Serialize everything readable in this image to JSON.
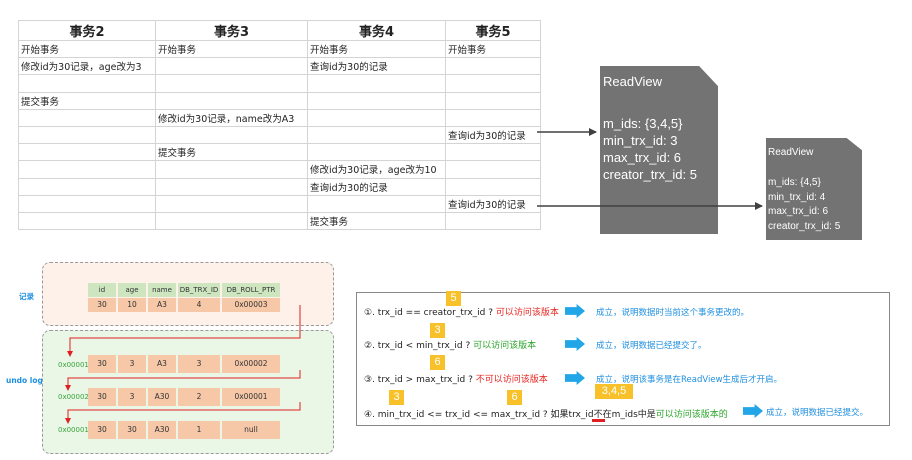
{
  "table": {
    "headers": [
      "事务2",
      "事务3",
      "事务4",
      "事务5"
    ],
    "rows": [
      [
        "开始事务",
        "开始事务",
        "开始事务",
        "开始事务"
      ],
      [
        "修改id为30记录，age改为3",
        "",
        "查询id为30的记录",
        ""
      ],
      [
        "",
        "",
        "",
        ""
      ],
      [
        "提交事务",
        "",
        "",
        ""
      ],
      [
        "",
        "修改id为30记录，name改为A3",
        "",
        ""
      ],
      [
        "",
        "",
        "",
        "查询id为30的记录"
      ],
      [
        "",
        "提交事务",
        "",
        ""
      ],
      [
        "",
        "",
        "修改id为30记录，age改为10",
        ""
      ],
      [
        "",
        "",
        "查询id为30的记录",
        ""
      ],
      [
        "",
        "",
        "",
        "查询id为30的记录"
      ],
      [
        "",
        "",
        "提交事务",
        ""
      ]
    ]
  },
  "readviews": [
    {
      "title": "ReadView",
      "m_ids": "m_ids: {3,4,5}",
      "min_trx_id": "min_trx_id: 3",
      "max_trx_id": "max_trx_id: 6",
      "creator_trx_id": "creator_trx_id: 5"
    },
    {
      "title": "ReadView",
      "m_ids": "m_ids: {4,5}",
      "min_trx_id": "min_trx_id: 4",
      "max_trx_id": "max_trx_id: 6",
      "creator_trx_id": "creator_trx_id: 5"
    }
  ],
  "labels": {
    "record": "记录",
    "undo_log": "undo log"
  },
  "record": {
    "headers": [
      "id",
      "age",
      "name",
      "DB_TRX_ID",
      "DB_ROLL_PTR"
    ],
    "values": [
      "30",
      "10",
      "A3",
      "4",
      "0x00003"
    ]
  },
  "undo_log": [
    {
      "addr": "0x00001",
      "values": [
        "30",
        "3",
        "A3",
        "3",
        "0x00002"
      ]
    },
    {
      "addr": "0x00002",
      "values": [
        "30",
        "3",
        "A30",
        "2",
        "0x00001"
      ]
    },
    {
      "addr": "0x00001",
      "values": [
        "30",
        "30",
        "A30",
        "1",
        "null"
      ]
    }
  ],
  "rules": [
    {
      "text": "①. trx_id  == creator_trx_id ? ",
      "ok": "可以访问该版本",
      "result": "成立，说明数据时当前这个事务更改的。",
      "tag": "5"
    },
    {
      "text": "②. trx_id < min_trx_id ? ",
      "ok": "可以访问该版本",
      "result": "成立，说明数据已经提交了。",
      "tag": "3"
    },
    {
      "text": "③. trx_id > max_trx_id ? ",
      "ok": "不可以访问该版本",
      "result": "成立，说明该事务是在ReadView生成后才开启。",
      "tag": "6"
    },
    {
      "text_a": "④. min_trx_id <= trx_id <= max_trx_id ? 如果trx_id",
      "text_b": "不在",
      "text_c": "m_ids中是",
      "ok": "可以访问该版本的",
      "result": "成立，说明数据已经提交。",
      "tag1": "3",
      "tag2": "6",
      "tag3": "3,4,5"
    }
  ],
  "colors": {
    "card": "#737373",
    "record_bg": "#fdf1ea",
    "undo_bg": "#eaf6e6",
    "header_cell": "#cde6c0",
    "data_cell": "#f6c8a8",
    "tag": "#f8c12a",
    "arrow_blue": "#22a6e8",
    "accent_red": "#e8251f",
    "accent_green": "#2aa42a"
  }
}
